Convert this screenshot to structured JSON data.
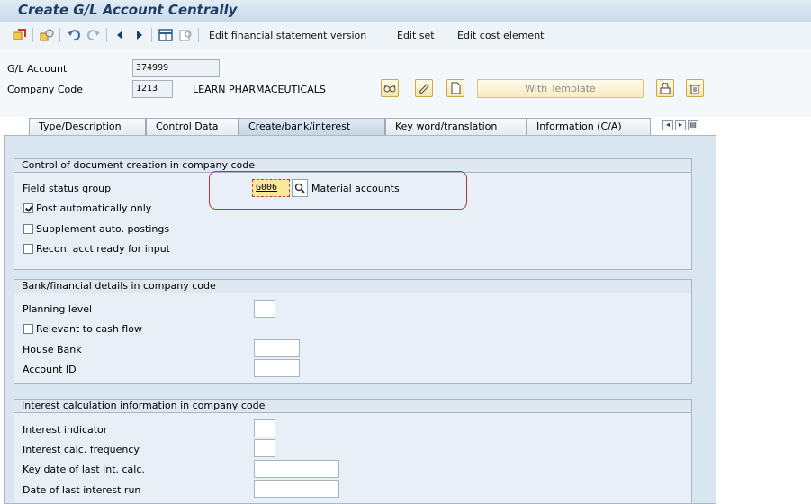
{
  "window": {
    "title": "Create G/L Account Centrally"
  },
  "toolbar": {
    "icons": [
      "display-change-icon",
      "other-object-icon",
      "undo-icon",
      "redo-icon",
      "previous-icon",
      "next-icon",
      "table-icon",
      "print-preview-icon"
    ],
    "links": [
      "Edit financial statement version",
      "Edit set",
      "Edit cost element"
    ]
  },
  "header": {
    "gl_account_label": "G/L Account",
    "gl_account_value": "374999",
    "company_code_label": "Company Code",
    "company_code_value": "1213",
    "company_name": "LEARN PHARMACEUTICALS",
    "with_template_label": "With Template"
  },
  "tabs": [
    {
      "label": "Type/Description",
      "active": false
    },
    {
      "label": "Control Data",
      "active": false
    },
    {
      "label": "Create/bank/interest",
      "active": true
    },
    {
      "label": "Key word/translation",
      "active": false
    },
    {
      "label": "Information (C/A)",
      "active": false
    }
  ],
  "group_document": {
    "title": "Control of document creation in company code",
    "field_status_group_label": "Field status group",
    "field_status_group_value": "G006",
    "field_status_group_desc": "Material accounts",
    "post_auto_label": "Post automatically only",
    "post_auto_checked": true,
    "supplement_label": "Supplement auto. postings",
    "supplement_checked": false,
    "recon_label": "Recon. acct ready for input",
    "recon_checked": false
  },
  "group_bank": {
    "title": "Bank/financial details in company code",
    "planning_level_label": "Planning level",
    "cash_flow_label": "Relevant to cash flow",
    "house_bank_label": "House Bank",
    "account_id_label": "Account ID"
  },
  "group_interest": {
    "title": "Interest calculation information in company code",
    "indicator_label": "Interest indicator",
    "frequency_label": "Interest calc. frequency",
    "key_date_label": "Key date of last int. calc.",
    "last_run_label": "Date of last interest run"
  }
}
